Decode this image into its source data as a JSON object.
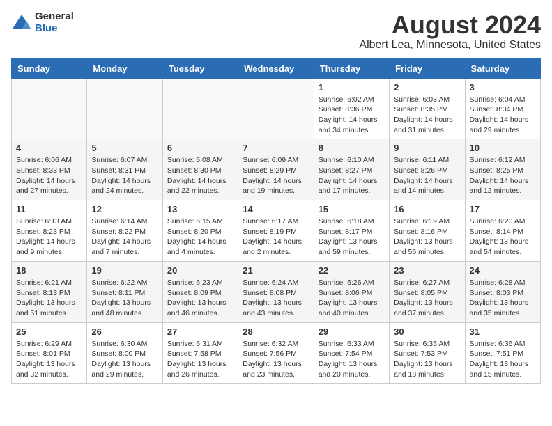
{
  "header": {
    "logo_general": "General",
    "logo_blue": "Blue",
    "title": "August 2024",
    "subtitle": "Albert Lea, Minnesota, United States"
  },
  "weekdays": [
    "Sunday",
    "Monday",
    "Tuesday",
    "Wednesday",
    "Thursday",
    "Friday",
    "Saturday"
  ],
  "weeks": [
    [
      {
        "day": "",
        "info": ""
      },
      {
        "day": "",
        "info": ""
      },
      {
        "day": "",
        "info": ""
      },
      {
        "day": "",
        "info": ""
      },
      {
        "day": "1",
        "info": "Sunrise: 6:02 AM\nSunset: 8:36 PM\nDaylight: 14 hours\nand 34 minutes."
      },
      {
        "day": "2",
        "info": "Sunrise: 6:03 AM\nSunset: 8:35 PM\nDaylight: 14 hours\nand 31 minutes."
      },
      {
        "day": "3",
        "info": "Sunrise: 6:04 AM\nSunset: 8:34 PM\nDaylight: 14 hours\nand 29 minutes."
      }
    ],
    [
      {
        "day": "4",
        "info": "Sunrise: 6:06 AM\nSunset: 8:33 PM\nDaylight: 14 hours\nand 27 minutes."
      },
      {
        "day": "5",
        "info": "Sunrise: 6:07 AM\nSunset: 8:31 PM\nDaylight: 14 hours\nand 24 minutes."
      },
      {
        "day": "6",
        "info": "Sunrise: 6:08 AM\nSunset: 8:30 PM\nDaylight: 14 hours\nand 22 minutes."
      },
      {
        "day": "7",
        "info": "Sunrise: 6:09 AM\nSunset: 8:29 PM\nDaylight: 14 hours\nand 19 minutes."
      },
      {
        "day": "8",
        "info": "Sunrise: 6:10 AM\nSunset: 8:27 PM\nDaylight: 14 hours\nand 17 minutes."
      },
      {
        "day": "9",
        "info": "Sunrise: 6:11 AM\nSunset: 8:26 PM\nDaylight: 14 hours\nand 14 minutes."
      },
      {
        "day": "10",
        "info": "Sunrise: 6:12 AM\nSunset: 8:25 PM\nDaylight: 14 hours\nand 12 minutes."
      }
    ],
    [
      {
        "day": "11",
        "info": "Sunrise: 6:13 AM\nSunset: 8:23 PM\nDaylight: 14 hours\nand 9 minutes."
      },
      {
        "day": "12",
        "info": "Sunrise: 6:14 AM\nSunset: 8:22 PM\nDaylight: 14 hours\nand 7 minutes."
      },
      {
        "day": "13",
        "info": "Sunrise: 6:15 AM\nSunset: 8:20 PM\nDaylight: 14 hours\nand 4 minutes."
      },
      {
        "day": "14",
        "info": "Sunrise: 6:17 AM\nSunset: 8:19 PM\nDaylight: 14 hours\nand 2 minutes."
      },
      {
        "day": "15",
        "info": "Sunrise: 6:18 AM\nSunset: 8:17 PM\nDaylight: 13 hours\nand 59 minutes."
      },
      {
        "day": "16",
        "info": "Sunrise: 6:19 AM\nSunset: 8:16 PM\nDaylight: 13 hours\nand 56 minutes."
      },
      {
        "day": "17",
        "info": "Sunrise: 6:20 AM\nSunset: 8:14 PM\nDaylight: 13 hours\nand 54 minutes."
      }
    ],
    [
      {
        "day": "18",
        "info": "Sunrise: 6:21 AM\nSunset: 8:13 PM\nDaylight: 13 hours\nand 51 minutes."
      },
      {
        "day": "19",
        "info": "Sunrise: 6:22 AM\nSunset: 8:11 PM\nDaylight: 13 hours\nand 48 minutes."
      },
      {
        "day": "20",
        "info": "Sunrise: 6:23 AM\nSunset: 8:09 PM\nDaylight: 13 hours\nand 46 minutes."
      },
      {
        "day": "21",
        "info": "Sunrise: 6:24 AM\nSunset: 8:08 PM\nDaylight: 13 hours\nand 43 minutes."
      },
      {
        "day": "22",
        "info": "Sunrise: 6:26 AM\nSunset: 8:06 PM\nDaylight: 13 hours\nand 40 minutes."
      },
      {
        "day": "23",
        "info": "Sunrise: 6:27 AM\nSunset: 8:05 PM\nDaylight: 13 hours\nand 37 minutes."
      },
      {
        "day": "24",
        "info": "Sunrise: 6:28 AM\nSunset: 8:03 PM\nDaylight: 13 hours\nand 35 minutes."
      }
    ],
    [
      {
        "day": "25",
        "info": "Sunrise: 6:29 AM\nSunset: 8:01 PM\nDaylight: 13 hours\nand 32 minutes."
      },
      {
        "day": "26",
        "info": "Sunrise: 6:30 AM\nSunset: 8:00 PM\nDaylight: 13 hours\nand 29 minutes."
      },
      {
        "day": "27",
        "info": "Sunrise: 6:31 AM\nSunset: 7:58 PM\nDaylight: 13 hours\nand 26 minutes."
      },
      {
        "day": "28",
        "info": "Sunrise: 6:32 AM\nSunset: 7:56 PM\nDaylight: 13 hours\nand 23 minutes."
      },
      {
        "day": "29",
        "info": "Sunrise: 6:33 AM\nSunset: 7:54 PM\nDaylight: 13 hours\nand 20 minutes."
      },
      {
        "day": "30",
        "info": "Sunrise: 6:35 AM\nSunset: 7:53 PM\nDaylight: 13 hours\nand 18 minutes."
      },
      {
        "day": "31",
        "info": "Sunrise: 6:36 AM\nSunset: 7:51 PM\nDaylight: 13 hours\nand 15 minutes."
      }
    ]
  ]
}
